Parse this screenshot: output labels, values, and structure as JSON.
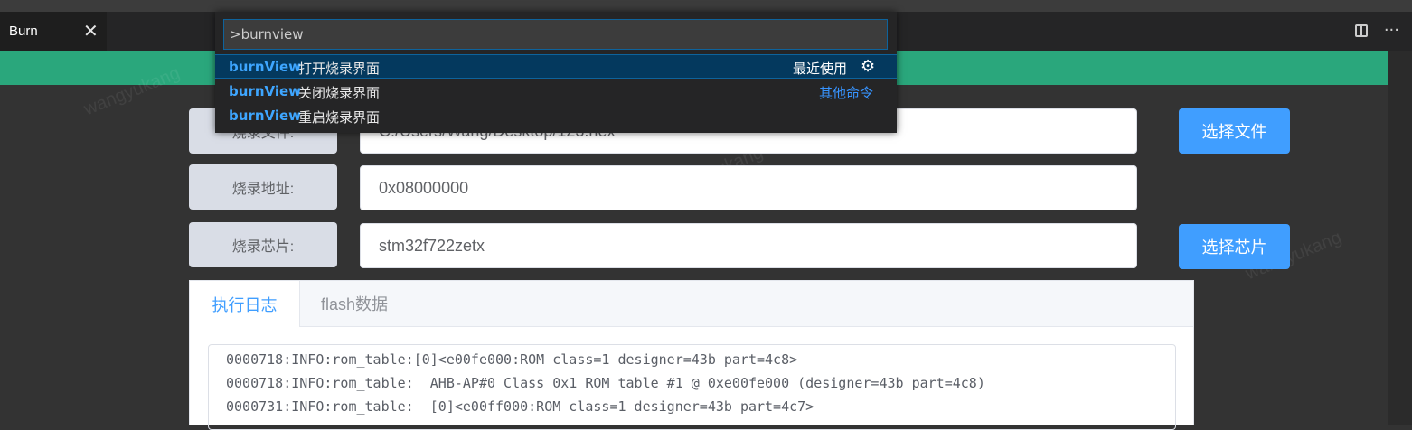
{
  "tab": {
    "title": "Burn",
    "close_glyph": "✕"
  },
  "editor_actions": {
    "more": "···"
  },
  "form": {
    "file_label": "烧录文件:",
    "file_value": "C:/Users/Wang/Desktop/123.hex",
    "address_label": "烧录地址:",
    "address_value": "0x08000000",
    "chip_label": "烧录芯片:",
    "chip_value": "stm32f722zetx",
    "select_file_button": "选择文件",
    "select_chip_button": "选择芯片"
  },
  "log_tabs": {
    "active": "执行日志",
    "inactive": "flash数据"
  },
  "log_lines": [
    "0000718:INFO:rom_table:[0]<e00fe000:ROM class=1 designer=43b part=4c8>",
    "0000718:INFO:rom_table:  AHB-AP#0 Class 0x1 ROM table #1 @ 0xe00fe000 (designer=43b part=4c8)",
    "0000731:INFO:rom_table:  [0]<e00ff000:ROM class=1 designer=43b part=4c7>"
  ],
  "watermark": "wangyukang",
  "palette": {
    "input_value": ">burnview",
    "items": [
      {
        "highlight": "burnView",
        "rest": "打开烧录界面",
        "right": "最近使用"
      },
      {
        "highlight": "burnView",
        "rest": "关闭烧录界面",
        "right": "其他命令"
      },
      {
        "highlight": "burnView",
        "rest": "重启烧录界面",
        "right": ""
      }
    ]
  },
  "icons": {
    "gear": "gear-icon",
    "split": "split-editor-icon",
    "close": "close-icon",
    "more": "more-icon"
  },
  "colors": {
    "accent_green": "#2aa77c",
    "primary_blue": "#409eff",
    "palette_selection": "#04395e"
  }
}
